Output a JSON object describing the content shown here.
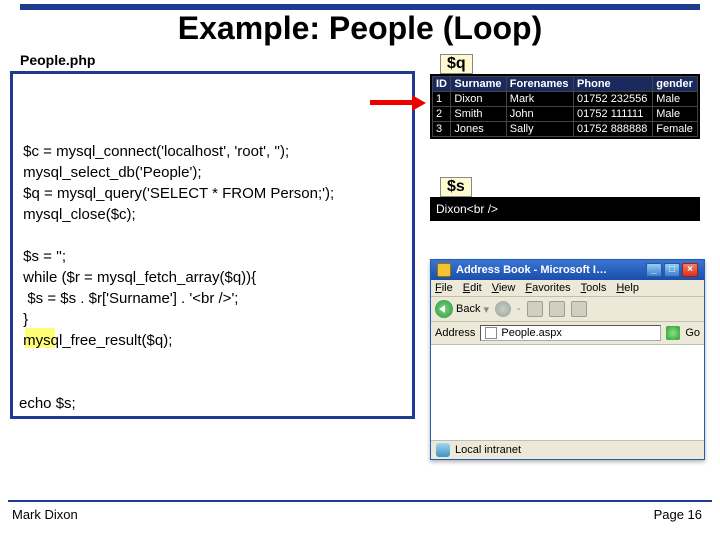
{
  "title": "Example: People (Loop)",
  "file_label": "People.php",
  "code_block": " $c = mysql_connect('localhost', 'root', '');\n mysql_select_db('People');\n $q = mysql_query('SELECT * FROM Person;');\n mysql_close($c);\n\n $s = '';\n while ($r = mysql_fetch_array($q)){\n  $s = $s . $r['Surname'] . '<br />';\n }\n mysql_free_result($q);\n\n\necho $s;",
  "q_var": {
    "label": "$q",
    "headers": [
      "ID",
      "Surname",
      "Forenames",
      "Phone",
      "gender"
    ],
    "rows": [
      [
        "1",
        "Dixon",
        "Mark",
        "01752 232556",
        "Male"
      ],
      [
        "2",
        "Smith",
        "John",
        "01752 111111",
        "Male"
      ],
      [
        "3",
        "Jones",
        "Sally",
        "01752 888888",
        "Female"
      ]
    ]
  },
  "s_var": {
    "label": "$s",
    "content": "Dixon<br />"
  },
  "browser": {
    "title": "Address Book - Microsoft I…",
    "menu": [
      "File",
      "Edit",
      "View",
      "Favorites",
      "Tools",
      "Help"
    ],
    "back_label": "Back",
    "address_label": "Address",
    "url": "People.aspx",
    "go_label": "Go",
    "status": "Local intranet"
  },
  "footer": {
    "left": "Mark Dixon",
    "right": "Page 16"
  }
}
